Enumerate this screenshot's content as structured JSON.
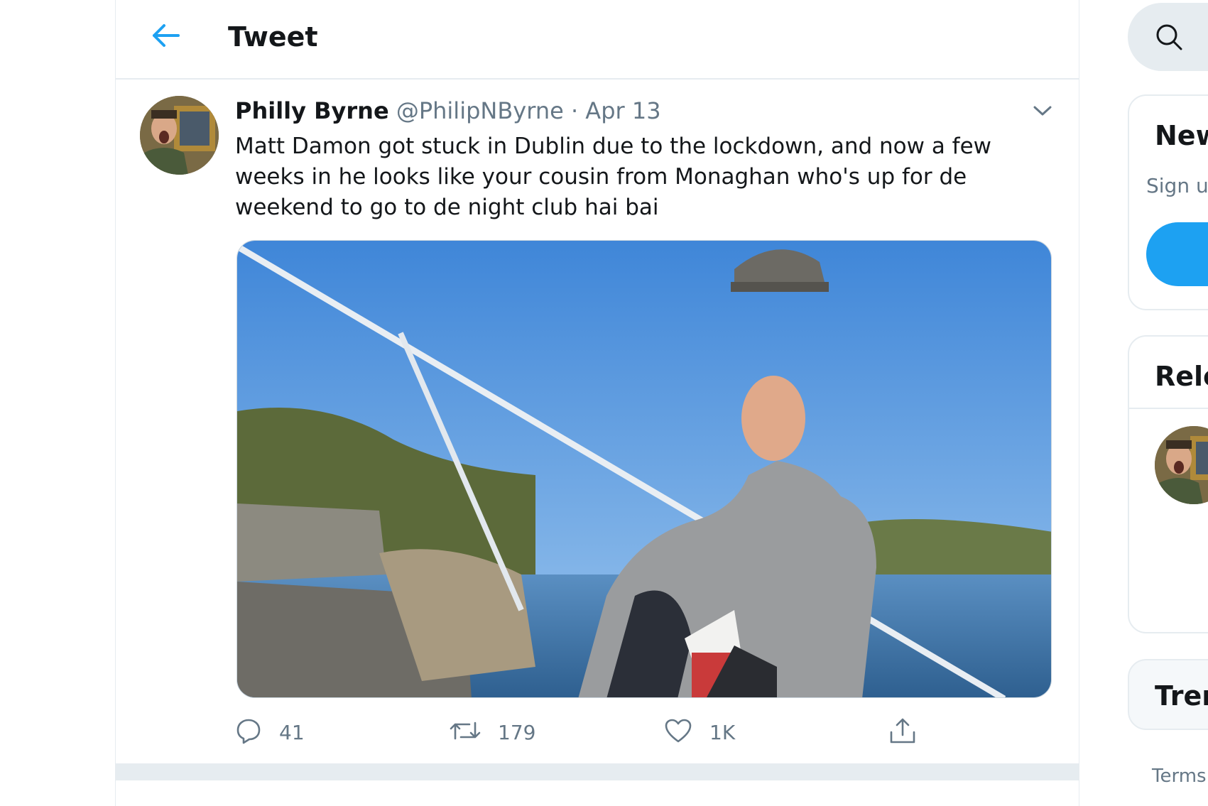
{
  "header": {
    "back_icon": "arrow-left-icon",
    "title": "Tweet"
  },
  "tweet": {
    "author_name": "Philly Byrne",
    "author_handle": "@PhilipNByrne",
    "separator": "·",
    "date": "Apr 13",
    "text": "Matt Damon got stuck in Dublin due to the lockdown, and now a few weeks in he looks like your cousin from Monaghan who's up for de weekend to go to de night club hai bai",
    "media_description": "photo",
    "actions": {
      "reply_count": "41",
      "retweet_count": "179",
      "like_count": "1K"
    }
  },
  "sidebar": {
    "search_icon": "search-icon",
    "new_card": {
      "title": "New",
      "subtitle": "Sign up"
    },
    "relevant_card": {
      "title": "Rele"
    },
    "trends_card": {
      "title": "Tren"
    },
    "footer_link": "Terms"
  },
  "colors": {
    "accent": "#1da1f2",
    "text_primary": "#14171a",
    "text_secondary": "#657786",
    "border": "#e6ecf0"
  }
}
